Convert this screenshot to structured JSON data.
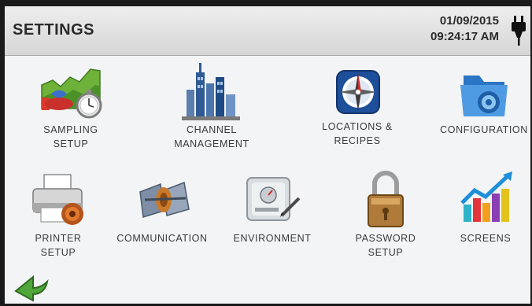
{
  "header": {
    "title": "SETTINGS",
    "date": "01/09/2015",
    "time": "09:24:17 AM",
    "power_icon": "plug-icon"
  },
  "tiles": [
    {
      "label": "SAMPLING\nSETUP",
      "icon": "sampling-chart-stopwatch-icon"
    },
    {
      "label": "CHANNEL\nMANAGEMENT",
      "icon": "city-bar-chart-icon"
    },
    {
      "label": "LOCATIONS &\nRECIPES",
      "icon": "compass-icon"
    },
    {
      "label": "CONFIGURATION",
      "icon": "folder-gear-icon"
    },
    {
      "label": "PRINTER\nSETUP",
      "icon": "printer-gear-icon"
    },
    {
      "label": "COMMUNICATION",
      "icon": "satellite-dish-icon"
    },
    {
      "label": "ENVIRONMENT",
      "icon": "control-panel-icon"
    },
    {
      "label": "PASSWORD\nSETUP",
      "icon": "padlock-icon"
    },
    {
      "label": "SCREENS",
      "icon": "colorful-bars-arrow-icon"
    }
  ],
  "footer": {
    "back_icon": "back-arrow-icon"
  }
}
